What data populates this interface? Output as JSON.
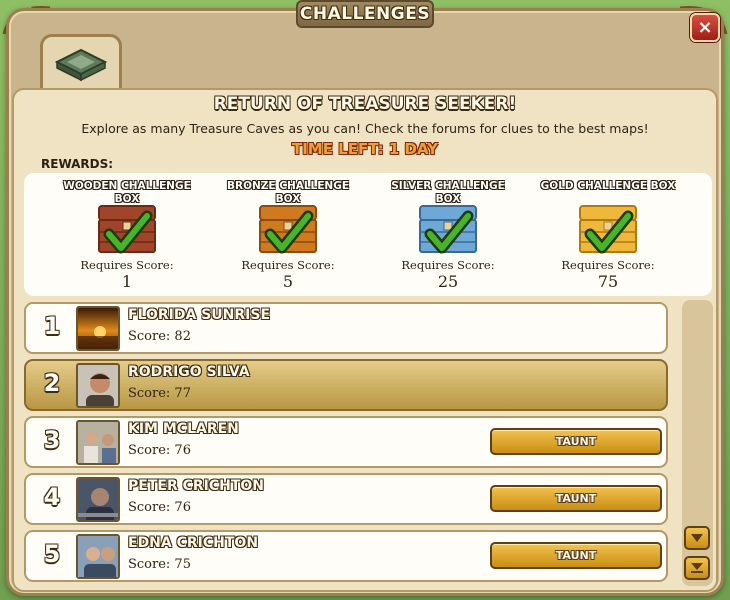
{
  "dialog": {
    "title": "CHALLENGES",
    "close_label": "×"
  },
  "challenge": {
    "title": "RETURN OF TREASURE SEEKER!",
    "description": "Explore as many Treasure Caves as you can! Check the forums for clues to the best maps!",
    "time_left": "TIME LEFT: 1 DAY"
  },
  "rewards": {
    "label": "REWARDS:",
    "items": [
      {
        "name": "WOODEN CHALLENGE BOX",
        "requires_label": "Requires Score:",
        "score": "1",
        "color": "#a0442a",
        "trim": "#6b2a14"
      },
      {
        "name": "BRONZE CHALLENGE BOX",
        "requires_label": "Requires Score:",
        "score": "5",
        "color": "#d07a1e",
        "trim": "#8a4a10"
      },
      {
        "name": "SILVER CHALLENGE BOX",
        "requires_label": "Requires Score:",
        "score": "25",
        "color": "#6ea8d6",
        "trim": "#3a6a94"
      },
      {
        "name": "GOLD CHALLENGE BOX",
        "requires_label": "Requires Score:",
        "score": "75",
        "color": "#f0b83a",
        "trim": "#b07a10"
      }
    ]
  },
  "leaderboard": [
    {
      "rank": "1",
      "name": "FLORIDA SUNRISE",
      "score": "Score: 82",
      "taunt": "",
      "highlight": false,
      "avatar": "sunset"
    },
    {
      "rank": "2",
      "name": "RODRIGO SILVA",
      "score": "Score: 77",
      "taunt": "",
      "highlight": true,
      "avatar": "person"
    },
    {
      "rank": "3",
      "name": "KIM MCLAREN",
      "score": "Score: 76",
      "taunt": "TAUNT",
      "highlight": false,
      "avatar": "group"
    },
    {
      "rank": "4",
      "name": "PETER CRICHTON",
      "score": "Score: 76",
      "taunt": "TAUNT",
      "highlight": false,
      "avatar": "person-dark"
    },
    {
      "rank": "5",
      "name": "EDNA CRICHTON",
      "score": "Score: 75",
      "taunt": "TAUNT",
      "highlight": false,
      "avatar": "couple"
    }
  ]
}
